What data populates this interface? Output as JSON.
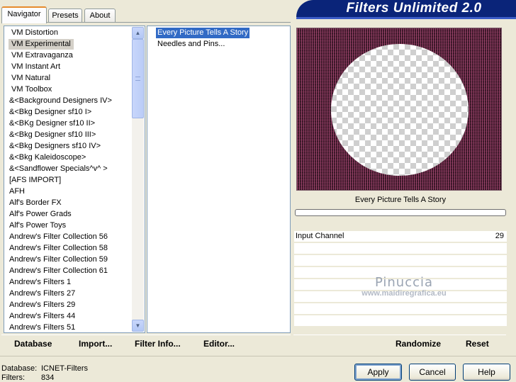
{
  "tabs": [
    {
      "label": "Navigator"
    },
    {
      "label": "Presets"
    },
    {
      "label": "About"
    }
  ],
  "title": "Filters Unlimited 2.0",
  "categories": [
    "VM Distortion",
    "VM Experimental",
    "VM Extravaganza",
    "VM Instant Art",
    "VM Natural",
    "VM Toolbox",
    "&<Background Designers IV>",
    "&<Bkg Designer sf10 I>",
    "&<BKg Designer sf10 II>",
    "&<Bkg Designer sf10 III>",
    "&<Bkg Designers sf10 IV>",
    "&<Bkg Kaleidoscope>",
    "&<Sandflower Specials^v^ >",
    "[AFS IMPORT]",
    "AFH",
    "Alf's Border FX",
    "Alf's Power Grads",
    "Alf's Power Toys",
    "Andrew's Filter Collection 56",
    "Andrew's Filter Collection 58",
    "Andrew's Filter Collection 59",
    "Andrew's Filter Collection 61",
    "Andrew's Filters 1",
    "Andrew's Filters 27",
    "Andrew's Filters 29",
    "Andrew's Filters 44",
    "Andrew's Filters 51"
  ],
  "filters": [
    "Every Picture Tells A Story",
    "Needles and Pins..."
  ],
  "preview": {
    "filter_name": "Every Picture Tells A Story",
    "progress": 0
  },
  "params": [
    {
      "label": "Input Channel",
      "value": "29"
    }
  ],
  "watermark": {
    "name": "Pinuccia",
    "url": "www.maidiregrafica.eu"
  },
  "toolbar": {
    "database": "Database",
    "import": "Import...",
    "filter_info": "Filter Info...",
    "editor": "Editor...",
    "randomize": "Randomize",
    "reset": "Reset"
  },
  "footer": {
    "database_label": "Database:",
    "database_value": "ICNET-Filters",
    "filters_label": "Filters:",
    "filters_value": "834"
  },
  "buttons": {
    "apply": "Apply",
    "cancel": "Cancel",
    "help": "Help"
  },
  "colors": {
    "title_bg": "#0a2479",
    "selection": "#316ac5",
    "preview_bg": "#4a1d32"
  }
}
